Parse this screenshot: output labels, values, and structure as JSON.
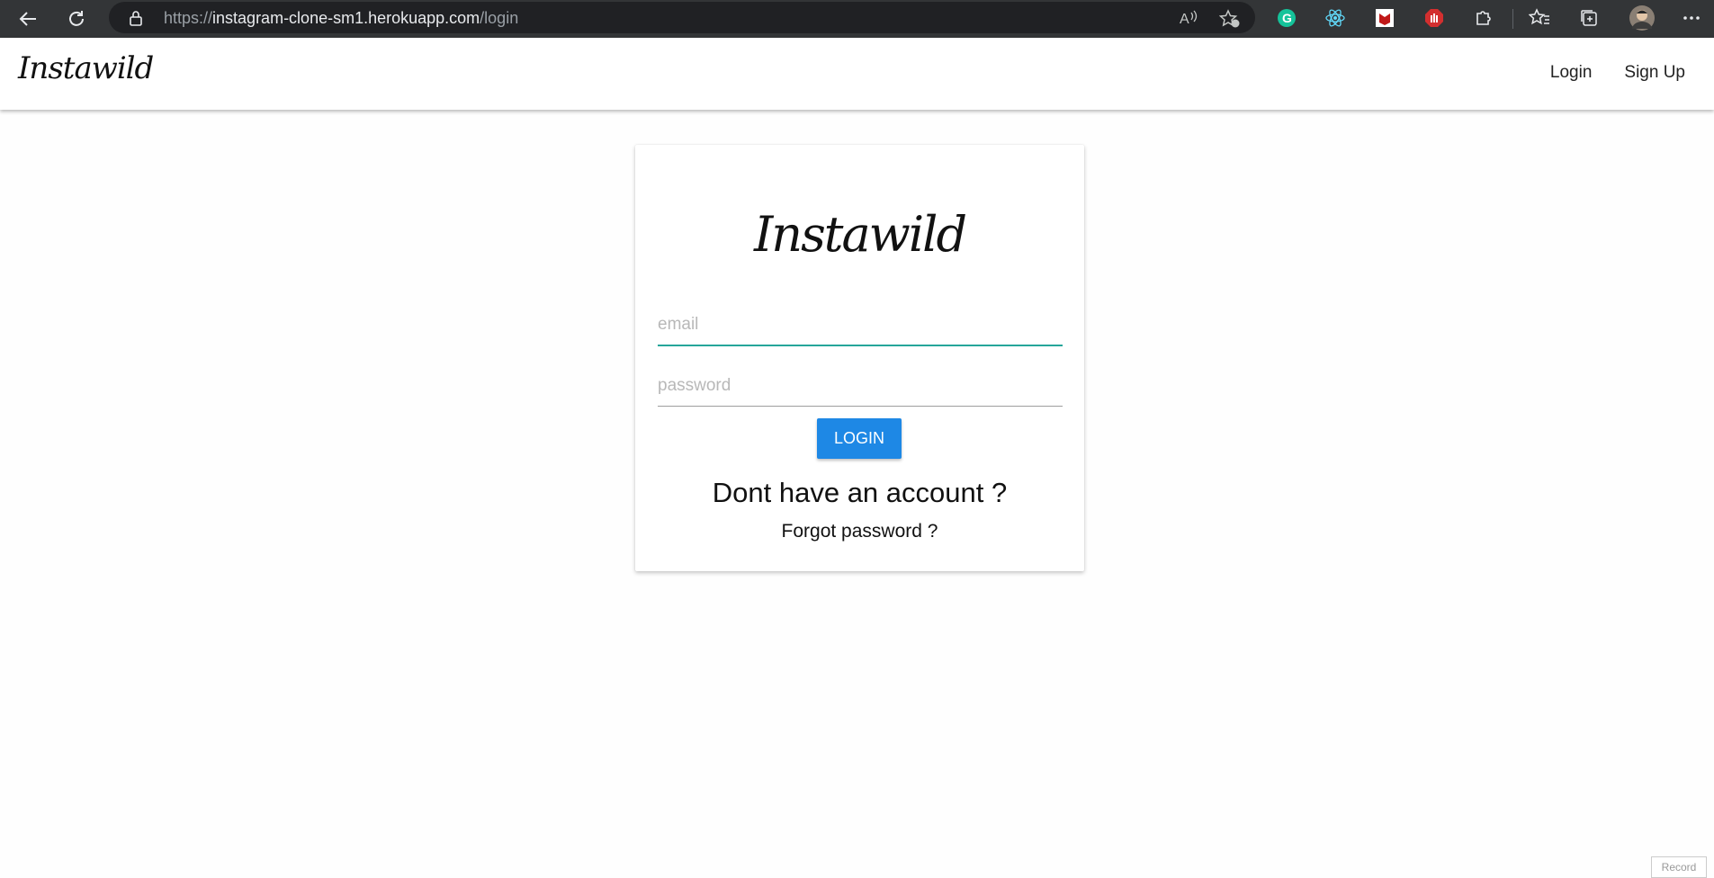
{
  "browser": {
    "url_prefix": "https://",
    "url_host": "instagram-clone-sm1.herokuapp.com",
    "url_path": "/login"
  },
  "navbar": {
    "brand": "Instawild",
    "links": [
      {
        "label": "Login"
      },
      {
        "label": "Sign Up"
      }
    ]
  },
  "login_card": {
    "brand": "Instawild",
    "email_placeholder": "email",
    "password_placeholder": "password",
    "login_button": "LOGIN",
    "signup_prompt": "Dont have an account ?",
    "forgot_password": "Forgot password ?"
  },
  "overlay": {
    "record_label": "Record"
  },
  "colors": {
    "accent_button": "#1e88e5",
    "focus_underline": "#26a69a",
    "chrome_bg": "#333537"
  }
}
